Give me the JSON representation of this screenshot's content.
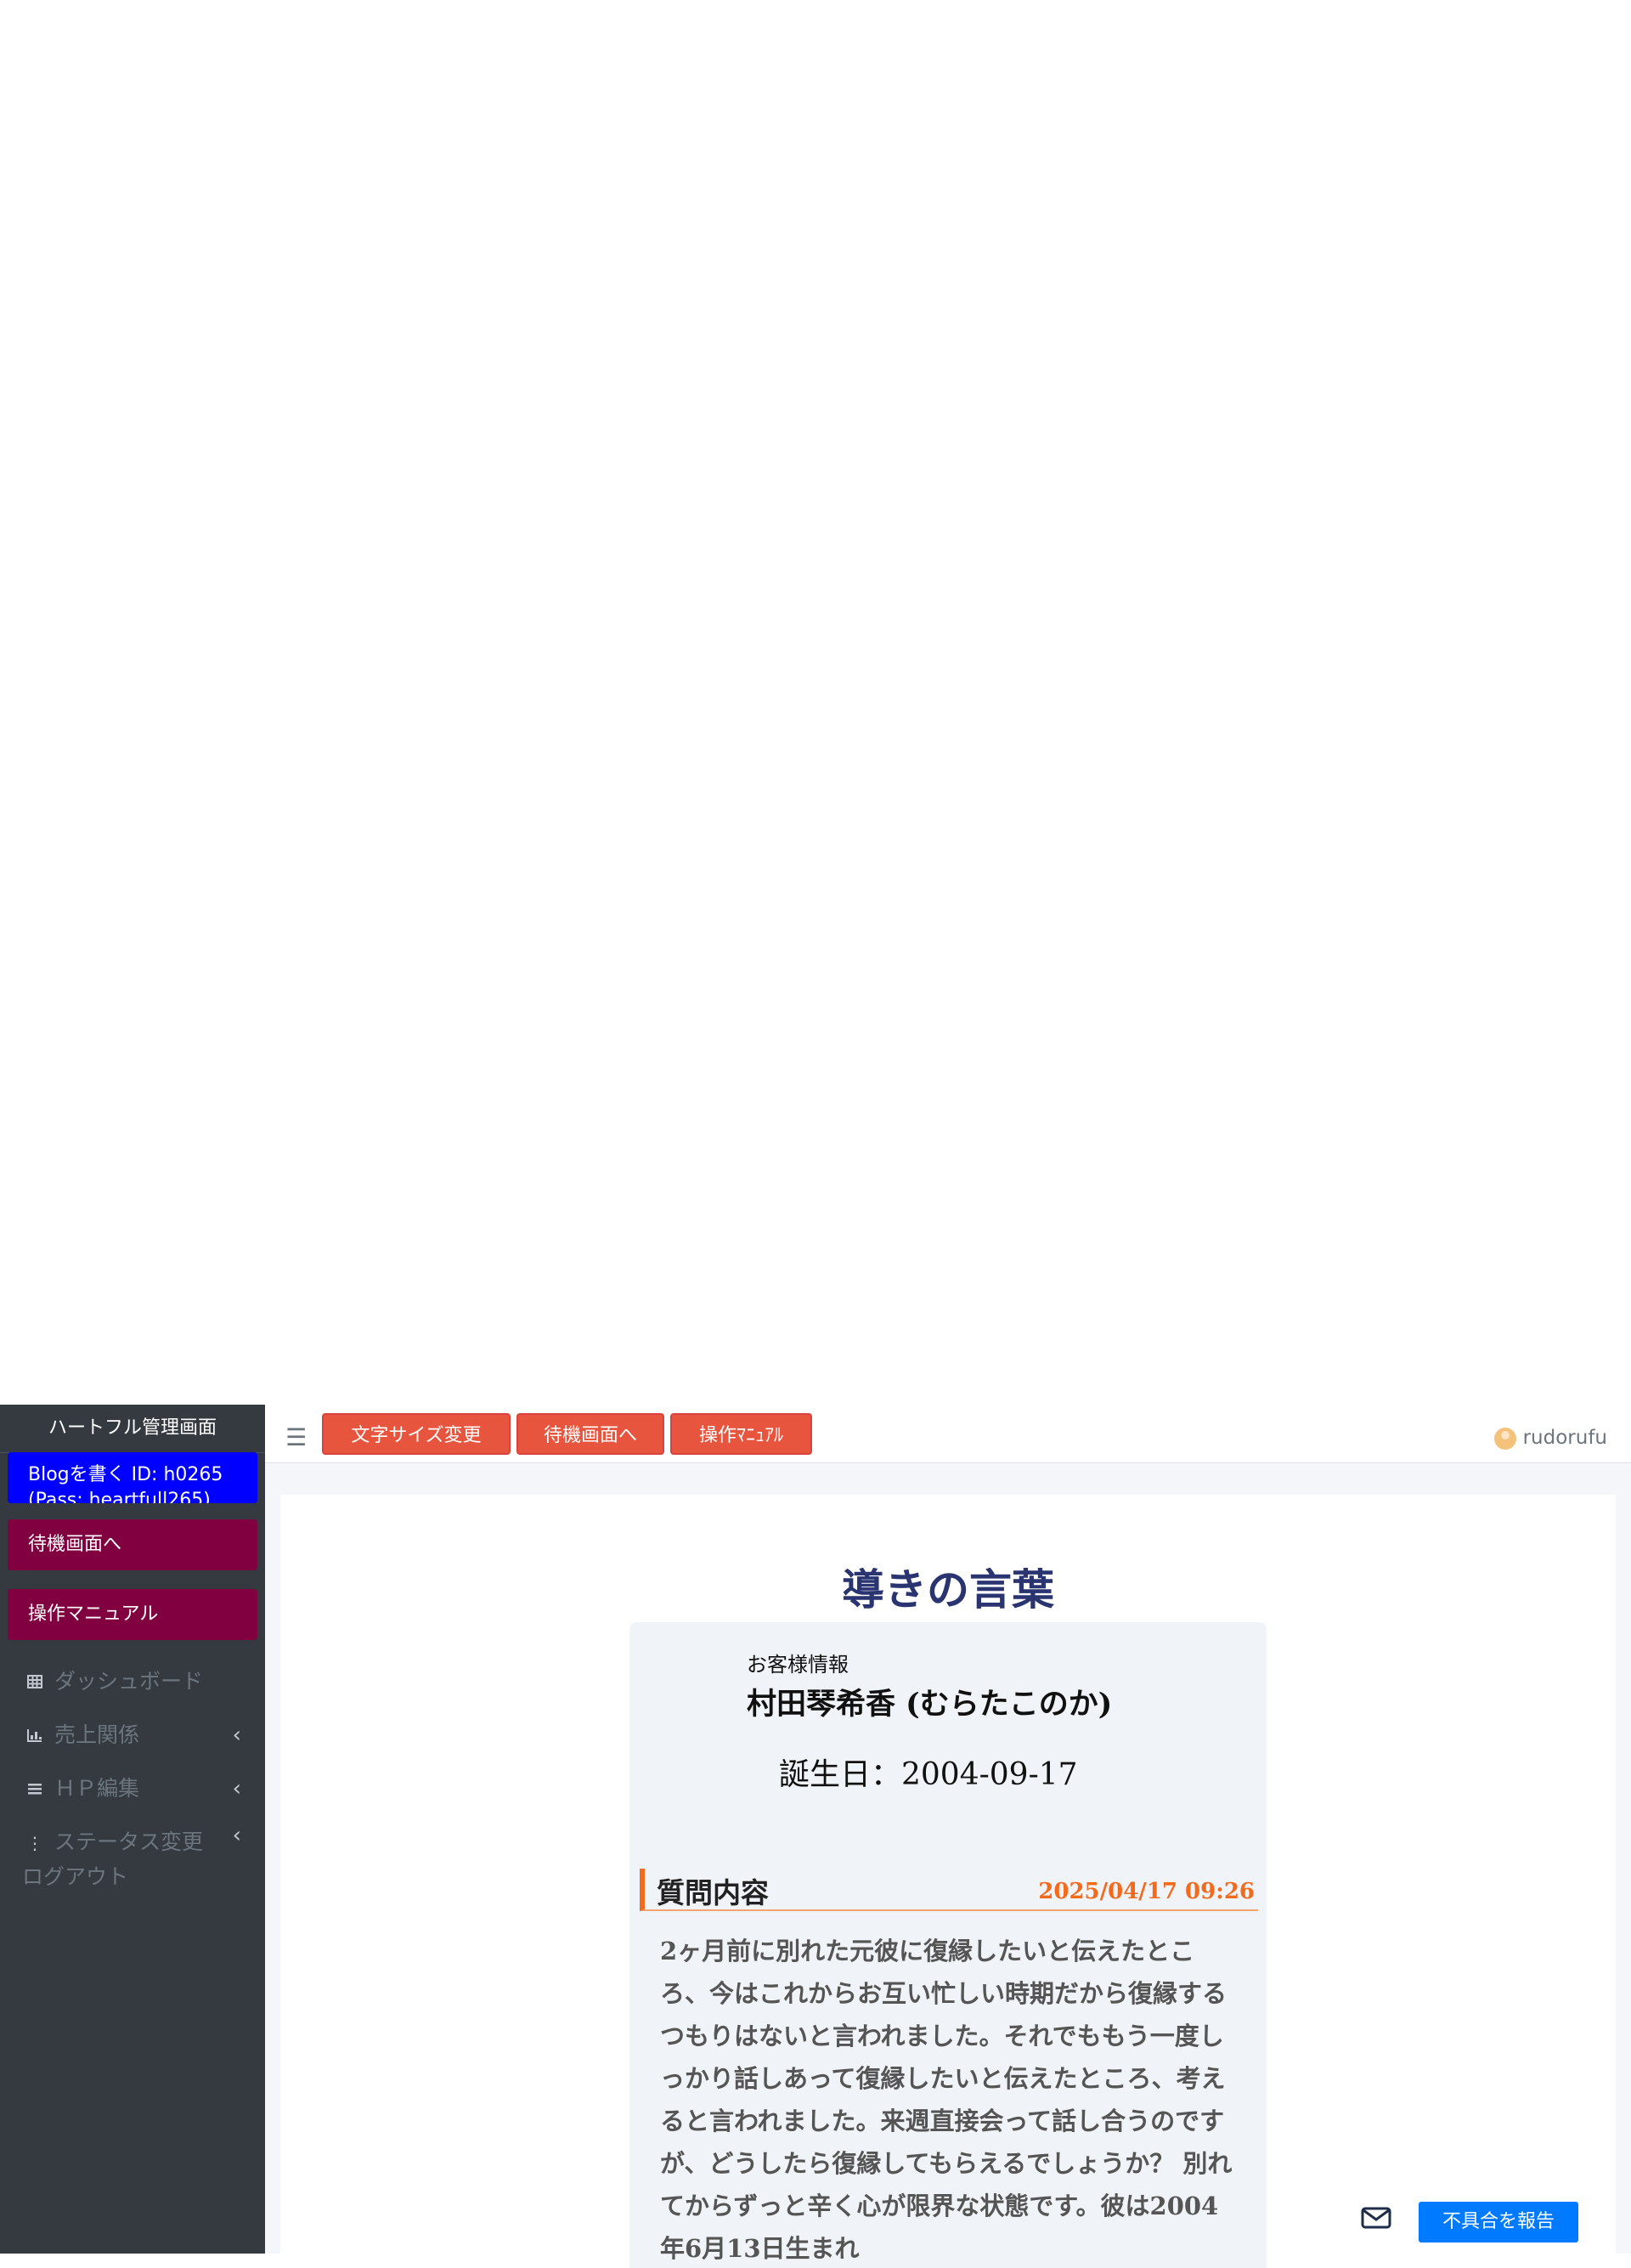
{
  "sidebar": {
    "brand": "ハートフル管理画面",
    "blog_button": "Blogを書く ID: h0265 (Pass: heartfull265)",
    "wait_button": "待機画面へ",
    "manual_button": "操作マニュアル",
    "nav": {
      "dashboard": "ダッシュボード",
      "sales": "売上関係",
      "hp_edit": "ＨＰ編集",
      "status_change": "ステータス変更",
      "logout": "ログアウト"
    }
  },
  "topbar": {
    "font_size_button": "文字サイズ変更",
    "wait_button": "待機画面へ",
    "manual_button": "操作ﾏﾆｭｱﾙ",
    "username": "rudorufu"
  },
  "main": {
    "title": "導きの言葉",
    "customer_label": "お客様情報",
    "customer_name": "村田琴希香 (むらたこのか)",
    "birthday": "誕生日：2004-09-17",
    "question_title": "質問内容",
    "question_datetime": "2025/04/17 09:26",
    "question_text": "2ヶ月前に別れた元彼に復縁したいと伝えたところ、今はこれからお互い忙しい時期だから復縁するつもりはないと言われました。それでももう一度しっかり話しあって復縁したいと伝えたところ、考えると言われました。来週直接会って話し合うのですが、どうしたら復縁してもらえるでしょうか？ 別れてからずっと辛く心が限界な状態です。彼は2004年6月13日生まれ"
  },
  "footer": {
    "report_button": "不具合を報告"
  },
  "colors": {
    "sidebar_bg": "#343a40",
    "blog_button": "#0000ff",
    "sidebar_buttons": "#800040",
    "top_buttons": "#e8553e",
    "title": "#2a3470",
    "accent_orange": "#f26b1d",
    "report_button": "#007bff"
  },
  "icons": {
    "menu": "hamburger-icon",
    "dashboard": "table-icon",
    "sales": "chart-icon",
    "hp_edit": "list-icon",
    "status": "vertical-dots-icon",
    "chevron": "chevron-left-icon",
    "mail": "envelope-icon"
  }
}
